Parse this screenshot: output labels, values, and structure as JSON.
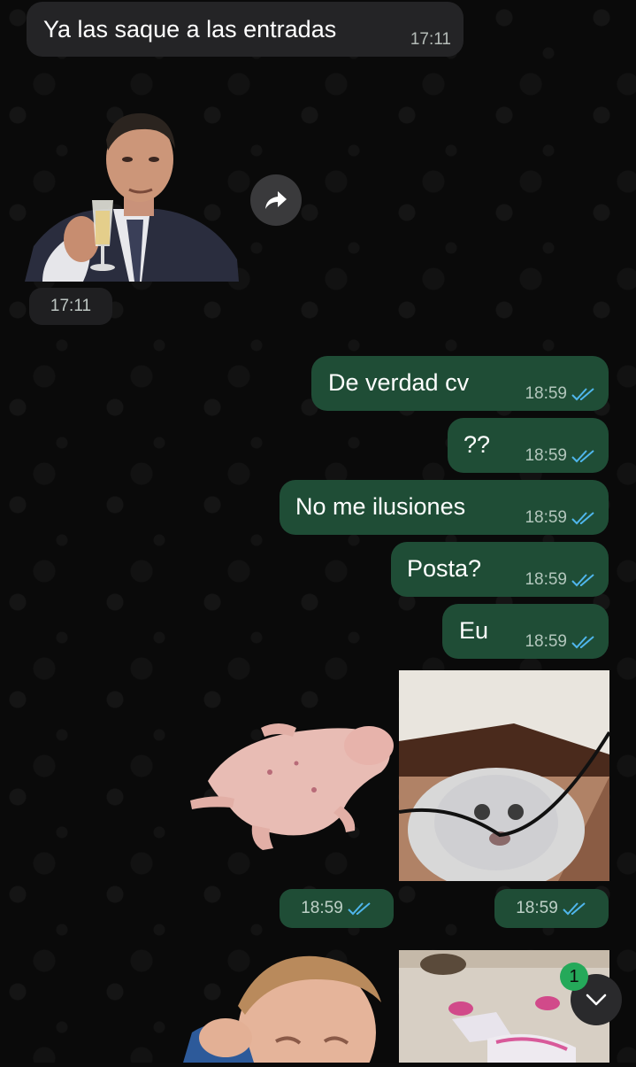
{
  "colors": {
    "incoming_bubble": "#242426",
    "outgoing_bubble": "#1f4d36",
    "read_ticks": "#4fb6ec",
    "badge": "#25a95a"
  },
  "messages": [
    {
      "text": "Ya las saque a las entradas",
      "time": "17:11",
      "direction": "incoming"
    },
    {
      "sticker": "man-toasting-sticker",
      "time": "17:11",
      "direction": "incoming"
    },
    {
      "text": "De verdad cv",
      "time": "18:59",
      "direction": "outgoing",
      "status": "read"
    },
    {
      "text": "??",
      "time": "18:59",
      "direction": "outgoing",
      "status": "read"
    },
    {
      "text": "No me ilusiones",
      "time": "18:59",
      "direction": "outgoing",
      "status": "read"
    },
    {
      "text": "Posta?",
      "time": "18:59",
      "direction": "outgoing",
      "status": "read"
    },
    {
      "text": "Eu",
      "time": "18:59",
      "direction": "outgoing",
      "status": "read"
    },
    {
      "sticker": "hairless-animal-sticker",
      "time": "18:59",
      "direction": "outgoing",
      "status": "read"
    },
    {
      "sticker": "cat-biting-cable-photo",
      "time": "18:59",
      "direction": "outgoing",
      "status": "read"
    },
    {
      "sticker": "crying-child-sticker",
      "direction": "outgoing"
    },
    {
      "sticker": "child-lying-on-floor-photo",
      "direction": "outgoing"
    }
  ],
  "scroll_down": {
    "icon": "chevron-down-icon",
    "unread_count": "1"
  },
  "forward": {
    "icon": "forward-icon"
  }
}
